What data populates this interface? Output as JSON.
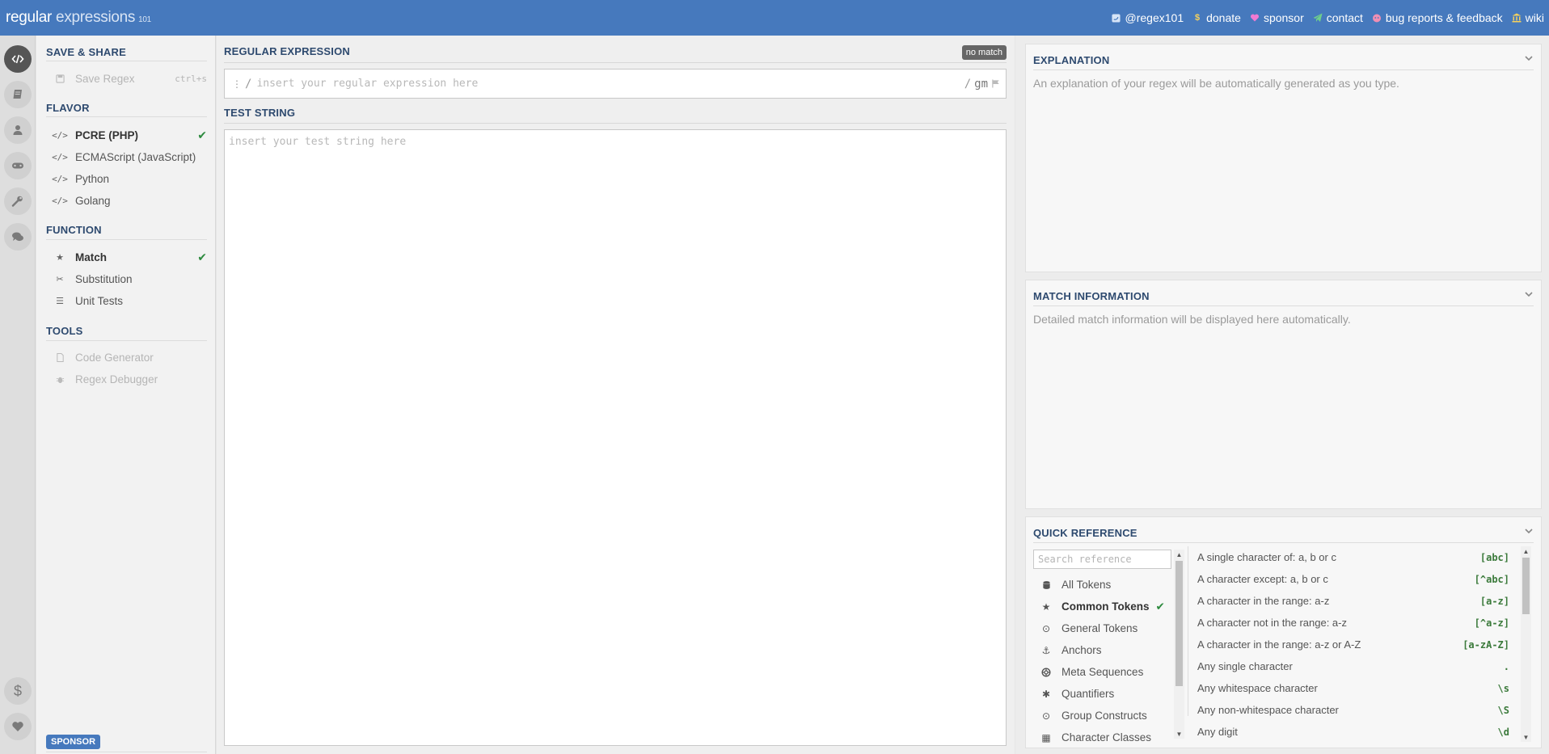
{
  "header": {
    "logo_part1": "regular",
    "logo_part2": "expressions",
    "logo_part3": "101",
    "links": [
      {
        "label": "@regex101",
        "icon": "twitter-icon"
      },
      {
        "label": "donate",
        "icon": "dollar-icon"
      },
      {
        "label": "sponsor",
        "icon": "heart-icon"
      },
      {
        "label": "contact",
        "icon": "paper-plane-icon"
      },
      {
        "label": "bug reports & feedback",
        "icon": "github-icon"
      },
      {
        "label": "wiki",
        "icon": "bank-icon"
      }
    ]
  },
  "rail": {
    "items": [
      "code-icon",
      "book-icon",
      "user-icon",
      "gamepad-icon",
      "wrench-icon",
      "comments-icon",
      "dollar-icon",
      "heart-icon"
    ]
  },
  "sidebar": {
    "save_share": {
      "title": "SAVE & SHARE",
      "save_label": "Save Regex",
      "save_shortcut": "ctrl+s"
    },
    "flavor": {
      "title": "FLAVOR",
      "items": [
        "PCRE (PHP)",
        "ECMAScript (JavaScript)",
        "Python",
        "Golang"
      ],
      "selected": "PCRE (PHP)"
    },
    "function": {
      "title": "FUNCTION",
      "items": [
        "Match",
        "Substitution",
        "Unit Tests"
      ],
      "selected": "Match"
    },
    "tools": {
      "title": "TOOLS",
      "items": [
        "Code Generator",
        "Regex Debugger"
      ]
    },
    "sponsor_badge": "SPONSOR"
  },
  "editor": {
    "regex_title": "REGULAR EXPRESSION",
    "match_status": "no match",
    "regex_delim": "/",
    "regex_placeholder": "insert your regular expression here",
    "regex_value": "",
    "flags_delim": "/",
    "flags": "gm",
    "test_title": "TEST STRING",
    "test_placeholder": "insert your test string here",
    "test_value": ""
  },
  "explanation": {
    "title": "EXPLANATION",
    "text": "An explanation of your regex will be automatically generated as you type."
  },
  "match_info": {
    "title": "MATCH INFORMATION",
    "text": "Detailed match information will be displayed here automatically."
  },
  "quick_ref": {
    "title": "QUICK REFERENCE",
    "search_placeholder": "Search reference",
    "categories": [
      {
        "label": "All Tokens",
        "icon": "database-icon"
      },
      {
        "label": "Common Tokens",
        "icon": "star-icon"
      },
      {
        "label": "General Tokens",
        "icon": "circle-dot-icon"
      },
      {
        "label": "Anchors",
        "icon": "anchor-icon"
      },
      {
        "label": "Meta Sequences",
        "icon": "lifebuoy-icon"
      },
      {
        "label": "Quantifiers",
        "icon": "asterisk-icon"
      },
      {
        "label": "Group Constructs",
        "icon": "circle-dot-icon"
      },
      {
        "label": "Character Classes",
        "icon": "grid-icon"
      }
    ],
    "selected_category": "Common Tokens",
    "rows": [
      {
        "desc": "A single character of: a, b or c",
        "token": "[abc]"
      },
      {
        "desc": "A character except: a, b or c",
        "token": "[^abc]"
      },
      {
        "desc": "A character in the range: a-z",
        "token": "[a-z]"
      },
      {
        "desc": "A character not in the range: a-z",
        "token": "[^a-z]"
      },
      {
        "desc": "A character in the range: a-z or A-Z",
        "token": "[a-zA-Z]"
      },
      {
        "desc": "Any single character",
        "token": "."
      },
      {
        "desc": "Any whitespace character",
        "token": "\\s"
      },
      {
        "desc": "Any non-whitespace character",
        "token": "\\S"
      },
      {
        "desc": "Any digit",
        "token": "\\d"
      }
    ]
  },
  "colors": {
    "brand": "#4679bd",
    "heading": "#2e4a6f",
    "check": "#2c8a3e",
    "token": "#3b7a3b"
  }
}
